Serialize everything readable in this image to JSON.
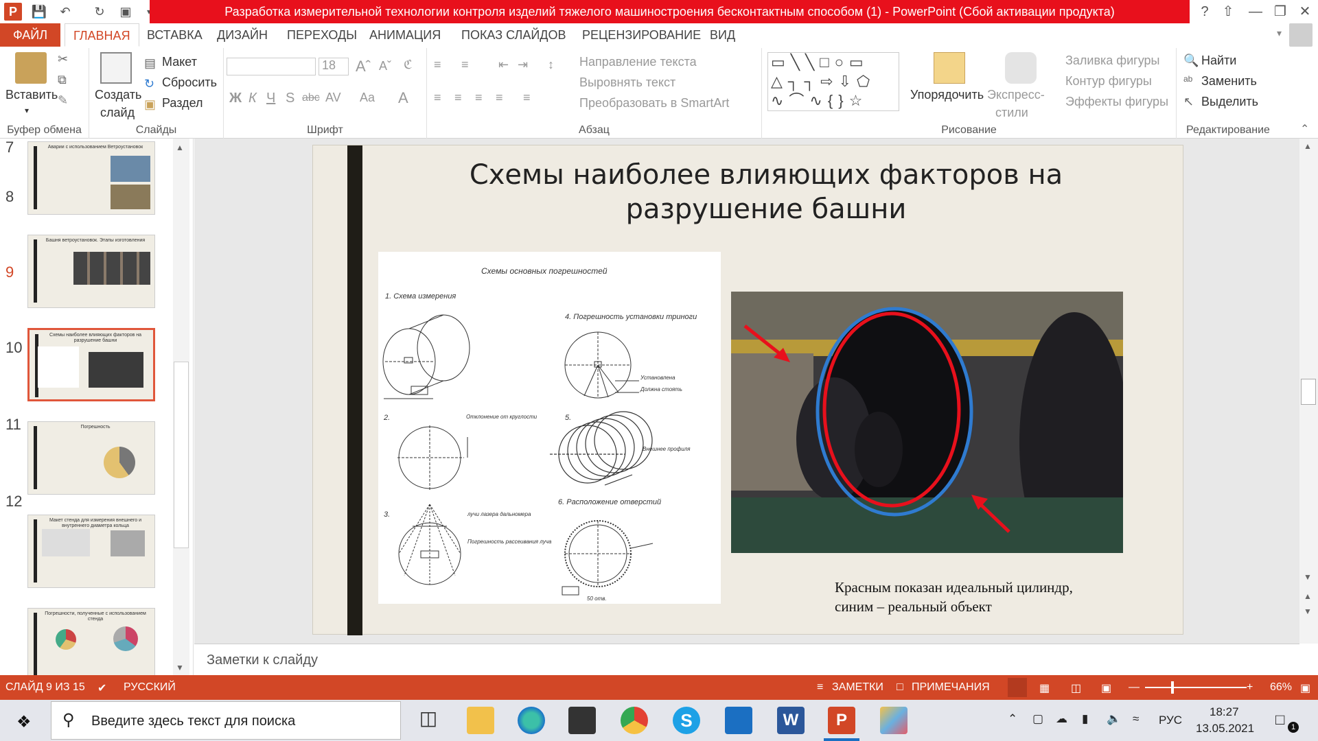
{
  "window": {
    "title": "Разработка измерительной технологии контроля изделий тяжелого машиностроения бесконтактным способом (1) -  PowerPoint (Сбой активации продукта)"
  },
  "tabs": [
    "ФАЙЛ",
    "ГЛАВНАЯ",
    "ВСТАВКА",
    "ДИЗАЙН",
    "ПЕРЕХОДЫ",
    "АНИМАЦИЯ",
    "ПОКАЗ СЛАЙДОВ",
    "РЕЦЕНЗИРОВАНИЕ",
    "ВИД"
  ],
  "ribbon": {
    "clipboard": {
      "paste": "Вставить",
      "label": "Буфер обмена"
    },
    "slides": {
      "new_slide_1": "Создать",
      "new_slide_2": "слайд",
      "layout": "Макет",
      "reset": "Сбросить",
      "section": "Раздел",
      "label": "Слайды"
    },
    "font": {
      "size": "18",
      "label": "Шрифт",
      "bold": "Ж",
      "italic": "К",
      "underline": "Ч",
      "shadow": "S",
      "strike": "abc",
      "spacing": "AV",
      "case": "Aa",
      "color": "A"
    },
    "paragraph": {
      "text_direction": "Направление текста",
      "align_text": "Выровнять текст",
      "smartart": "Преобразовать в SmartArt",
      "label": "Абзац"
    },
    "drawing": {
      "arrange": "Упорядочить",
      "quick_styles_1": "Экспресс-",
      "quick_styles_2": "стили",
      "fill": "Заливка фигуры",
      "outline": "Контур фигуры",
      "effects": "Эффекты фигуры",
      "label": "Рисование"
    },
    "editing": {
      "find": "Найти",
      "replace": "Заменить",
      "select": "Выделить",
      "label": "Редактирование"
    }
  },
  "thumbnails": [
    {
      "num": "7",
      "title": "Аварии с использованием Ветроустановок"
    },
    {
      "num": "8",
      "title": "Башня ветроустановок. Этапы изготовления"
    },
    {
      "num": "9",
      "title": "Схемы наиболее влияющих   факторов на разрушение башни"
    },
    {
      "num": "10",
      "title": "Погрешность"
    },
    {
      "num": "11",
      "title": "Макет стенда для измерения внешнего и внутреннего  диаметра кольца"
    },
    {
      "num": "12",
      "title": "Погрешности, полученные с использованием стенда"
    }
  ],
  "slide": {
    "title_line1": "Схемы наиболее влияющих   факторов на",
    "title_line2": "разрушение башни",
    "schemes": {
      "heading": "Схемы  основных погрешностей",
      "s1": "1. Схема измерения",
      "s4": "4. Погрешность установки триноги",
      "s2": "2.",
      "s2_note": "Отклонение от круглости",
      "s5": "5.",
      "s5_note": "Внешнее профиля",
      "s3": "3.",
      "s3_note1": "лучи лазера дальномера",
      "s3_note2": "Погрешность рассеивания луча",
      "s4_note1": "Установлена",
      "s4_note2": "Должна стоять",
      "s6": "6. Расположение отверстий",
      "s6_note": "50 отв."
    },
    "caption_line1": "Красным показан идеальный цилиндр,",
    "caption_line2": "синим – реальный объект"
  },
  "notes": "Заметки к слайду",
  "status": {
    "slide_counter": "СЛАЙД 9 ИЗ 15",
    "language": "РУССКИЙ",
    "notes_btn": "ЗАМЕТКИ",
    "comments_btn": "ПРИМЕЧАНИЯ",
    "zoom": "66%"
  },
  "taskbar": {
    "search_placeholder": "Введите здесь текст для поиска",
    "lang": "РУС",
    "time": "18:27",
    "date": "13.05.2021",
    "notif_count": "1"
  },
  "colors": {
    "accent": "#d24726",
    "title_red": "#e8101c",
    "ideal_circle": "#e8101c",
    "real_circle": "#2f7bd0"
  }
}
